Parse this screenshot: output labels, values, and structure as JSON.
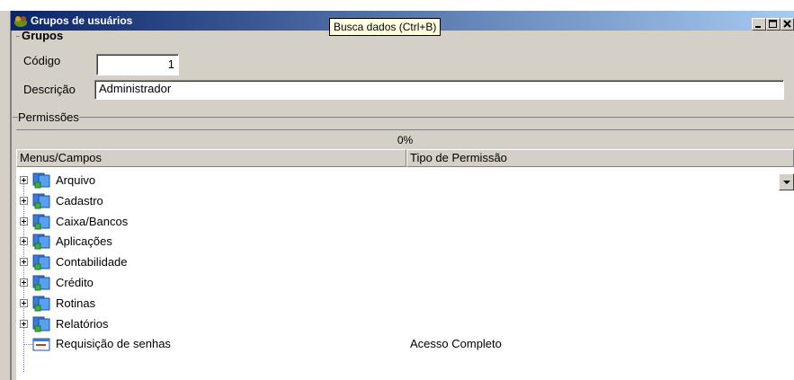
{
  "window": {
    "title": "Grupos de usuários",
    "tooltip": "Busca dados (Ctrl+B)"
  },
  "grupos": {
    "legend": "Grupos",
    "codigo_label": "Código",
    "codigo_value": "1",
    "descricao_label": "Descrição",
    "descricao_value": "Administrador"
  },
  "permissoes": {
    "legend": "Permissões",
    "progress_text": "0%",
    "progress_value": 0,
    "columns": [
      "Menus/Campos",
      "Tipo de Permissão"
    ],
    "rows": [
      {
        "label": "Arquivo",
        "permission": "",
        "icon": "folder-icon",
        "expandable": true
      },
      {
        "label": "Cadastro",
        "permission": "",
        "icon": "folder-icon",
        "expandable": true
      },
      {
        "label": "Caixa/Bancos",
        "permission": "",
        "icon": "folder-icon",
        "expandable": true
      },
      {
        "label": "Aplicações",
        "permission": "",
        "icon": "folder-icon",
        "expandable": true
      },
      {
        "label": "Contabilidade",
        "permission": "",
        "icon": "folder-icon",
        "expandable": true
      },
      {
        "label": "Crédito",
        "permission": "",
        "icon": "folder-icon",
        "expandable": true
      },
      {
        "label": "Rotinas",
        "permission": "",
        "icon": "folder-icon",
        "expandable": true
      },
      {
        "label": "Relatórios",
        "permission": "",
        "icon": "folder-icon",
        "expandable": true
      },
      {
        "label": "Requisição de senhas",
        "permission": "Acesso Completo",
        "icon": "form-icon",
        "expandable": false
      }
    ]
  },
  "colors": {
    "titlebar_start": "#0a246a",
    "titlebar_end": "#a6caf0",
    "window_bg": "#d4d0c8",
    "tooltip_bg": "#ffffe1"
  }
}
